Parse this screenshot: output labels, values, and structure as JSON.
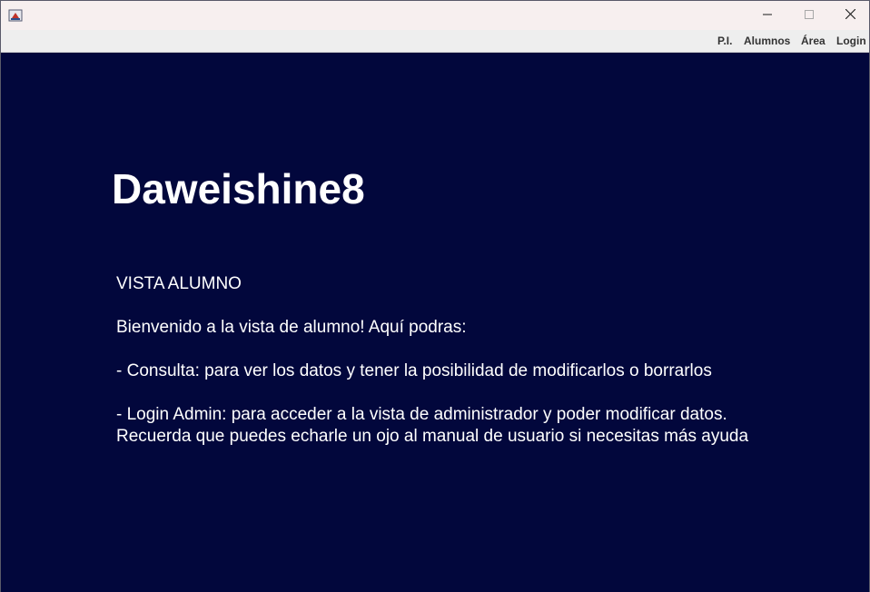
{
  "window": {
    "icon": "java-app-icon",
    "controls": {
      "minimize_icon": "minimize-icon",
      "maximize_icon": "maximize-icon",
      "close_icon": "close-icon"
    }
  },
  "menu": {
    "items": [
      {
        "label": "P.I."
      },
      {
        "label": "Alumnos"
      },
      {
        "label": "Área"
      },
      {
        "label": "Login"
      }
    ]
  },
  "main": {
    "title": "Daweishine8",
    "heading": "VISTA ALUMNO",
    "welcome": "Bienvenido a la vista de alumno! Aquí podras:",
    "bullet_consulta": "- Consulta: para ver los datos y tener la posibilidad de modificarlos o borrarlos",
    "bullet_login": "- Login Admin: para acceder a la vista de administrador y poder modificar datos.",
    "help_note": "Recuerda que puedes echarle un ojo al manual de usuario si necesitas más ayuda"
  },
  "colors": {
    "content_background": "#02073c",
    "content_text": "#ffffff",
    "menubar_background": "#eeeeee",
    "titlebar_background": "#f7efef"
  }
}
